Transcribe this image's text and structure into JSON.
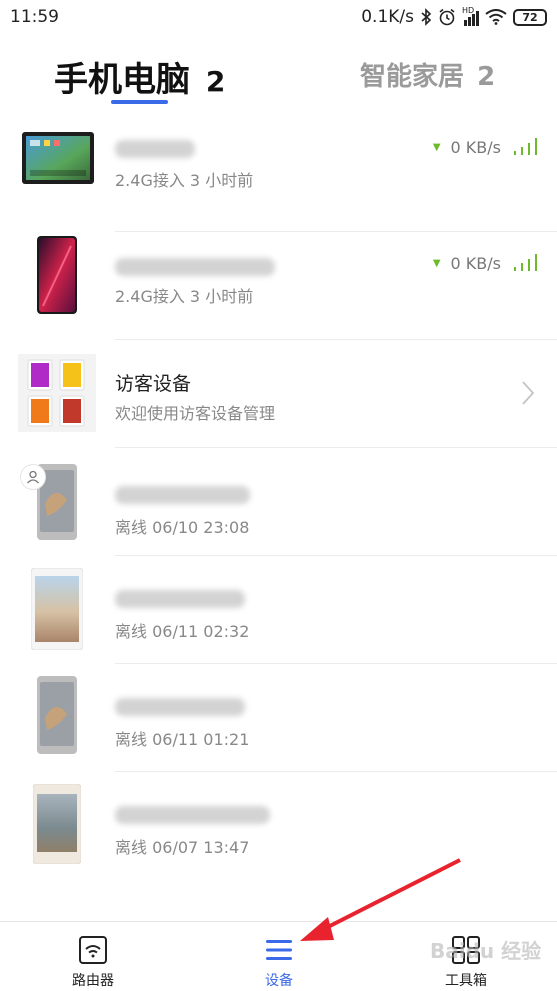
{
  "status_bar": {
    "time": "11:59",
    "net_speed": "0.1K/s",
    "network_type": "HD",
    "battery": "72",
    "icons": [
      "bluetooth-icon",
      "alarm-icon",
      "cell-signal-icon",
      "wifi-icon",
      "battery-icon"
    ]
  },
  "tabs": [
    {
      "label": "手机电脑",
      "count": "2",
      "active": true
    },
    {
      "label": "智能家居",
      "count": "2",
      "active": false
    }
  ],
  "online_devices": [
    {
      "sub": "2.4G接入  3 小时前",
      "speed": "0 KB/s",
      "thumb": "tablet"
    },
    {
      "sub": "2.4G接入  3 小时前",
      "speed": "0 KB/s",
      "thumb": "phone-red"
    }
  ],
  "guest": {
    "title": "访客设备",
    "sub": "欢迎使用访客设备管理"
  },
  "offline_devices": [
    {
      "sub": "离线  06/10 23:08",
      "thumb": "phone-gray"
    },
    {
      "sub": "离线  06/11 02:32",
      "thumb": "tablet-white"
    },
    {
      "sub": "离线  06/11 01:21",
      "thumb": "phone-gray"
    },
    {
      "sub": "离线  06/07 13:47",
      "thumb": "phone-white"
    }
  ],
  "bottom_nav": [
    {
      "label": "路由器",
      "icon": "router-icon",
      "active": false
    },
    {
      "label": "设备",
      "icon": "devices-icon",
      "active": true
    },
    {
      "label": "工具箱",
      "icon": "toolbox-icon",
      "active": false
    }
  ],
  "colors": {
    "accent": "#3b6ae8",
    "signal_green": "#6dbb2a",
    "annotation_red": "#e8232d"
  },
  "watermark": "Baidu 经验"
}
